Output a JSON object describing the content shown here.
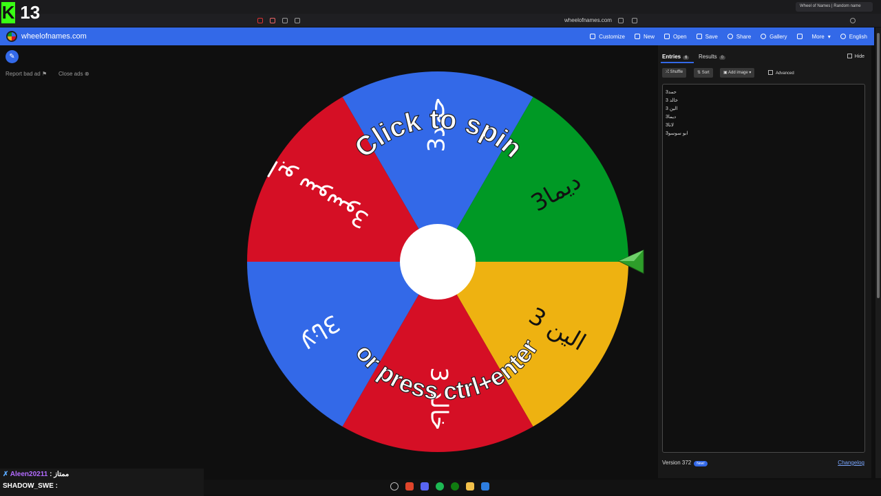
{
  "overlay": {
    "counter": "13",
    "chat_user": "Aleen20211",
    "chat_sep": ":",
    "chat_msg": "ممتاز",
    "streamer": "SHADOW_SWE :"
  },
  "browser": {
    "url": "wheelofnames.com",
    "tab_title": "Wheel of Names | Random name"
  },
  "app": {
    "site_name": "wheelofnames.com",
    "menu": [
      {
        "label": "Customize",
        "icon": "palette-icon"
      },
      {
        "label": "New",
        "icon": "new-file-icon"
      },
      {
        "label": "Open",
        "icon": "folder-icon"
      },
      {
        "label": "Save",
        "icon": "save-icon"
      },
      {
        "label": "Share",
        "icon": "share-icon"
      },
      {
        "label": "Gallery",
        "icon": "search-icon"
      },
      {
        "label": "",
        "icon": "fullscreen-icon"
      },
      {
        "label": "More",
        "icon": "chevron-down-icon"
      },
      {
        "label": "English",
        "icon": "globe-icon"
      }
    ],
    "report_ad": "Report bad ad",
    "close_ads": "Close ads"
  },
  "wheel": {
    "center_text_top": "Click to spin",
    "center_text_bottom": "or press ctrl+enter",
    "slices": [
      {
        "label": "حمد3",
        "color": "#3369e8"
      },
      {
        "label": "ديما3",
        "color": "#009925"
      },
      {
        "label": "الين 3",
        "color": "#eeb211"
      },
      {
        "label": "خالد 3",
        "color": "#d50f25"
      },
      {
        "label": "لانا3",
        "color": "#3369e8"
      },
      {
        "label": "ابو سوسو3",
        "color": "#d50f25"
      }
    ]
  },
  "panel": {
    "tab_entries": "Entries",
    "entries_count": "6",
    "tab_results": "Results",
    "results_count": "0",
    "hide": "Hide",
    "shuffle": "Shuffle",
    "sort": "Sort",
    "add_image": "Add image",
    "advanced": "Advanced",
    "entries": [
      "حمد3",
      "خالد 3",
      "الين 3",
      "ديما3",
      "لانا3",
      "ابو سوسو3"
    ],
    "version": "Version 372",
    "new_badge": "New!",
    "changelog": "Changelog"
  },
  "colors": {
    "brand": "#3369e8",
    "blue": "#3369e8",
    "green": "#009925",
    "yellow": "#eeb211",
    "red": "#d50f25"
  }
}
